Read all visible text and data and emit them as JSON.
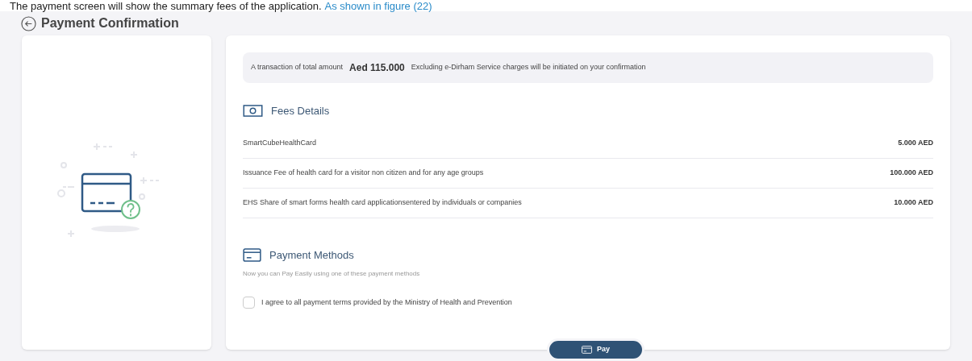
{
  "caption": {
    "text": "The payment screen will show the summary fees of the application.",
    "link": "As shown in figure (22)"
  },
  "header": {
    "title": "Payment Confirmation"
  },
  "notice": {
    "before": "A transaction of total amount",
    "amount": "Aed 115.000",
    "after": "Excluding e-Dirham Service charges will be initiated on your confirmation"
  },
  "fees": {
    "title": "Fees Details",
    "rows": [
      {
        "label": "SmartCubeHealthCard",
        "amount": "5.000 AED"
      },
      {
        "label": "Issuance Fee of health card for a visitor non citizen and for any age groups",
        "amount": "100.000 AED"
      },
      {
        "label": "EHS Share of smart forms health card applicationsentered by individuals or companies",
        "amount": "10.000 AED"
      }
    ]
  },
  "payment_methods": {
    "title": "Payment Methods",
    "subtitle": "Now you can Pay Easily using one of these payment methods"
  },
  "agreement": {
    "label": "I agree to all payment terms provided by the Ministry of Health and Prevention",
    "checked": false
  },
  "pay_button": {
    "label": "Pay"
  }
}
